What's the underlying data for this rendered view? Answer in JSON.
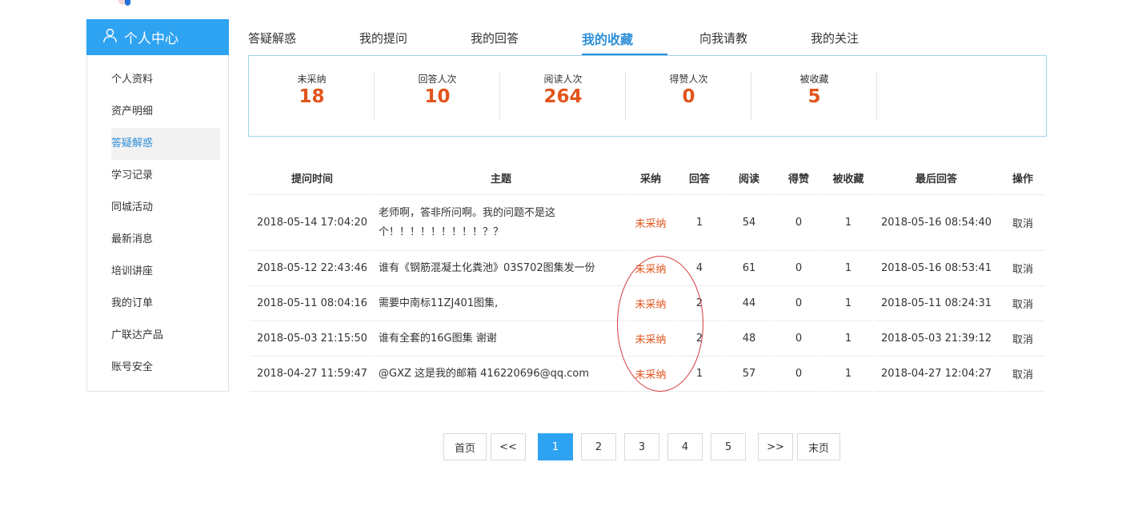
{
  "sidebar": {
    "title": "个人中心",
    "items": [
      {
        "label": "个人资料"
      },
      {
        "label": "资产明细"
      },
      {
        "label": "答疑解惑",
        "active": true
      },
      {
        "label": "学习记录"
      },
      {
        "label": "同城活动"
      },
      {
        "label": "最新消息"
      },
      {
        "label": "培训讲座"
      },
      {
        "label": "我的订单"
      },
      {
        "label": "广联达产品"
      },
      {
        "label": "账号安全"
      }
    ]
  },
  "tabs": [
    {
      "label": "答疑解惑"
    },
    {
      "label": "我的提问"
    },
    {
      "label": "我的回答"
    },
    {
      "label": "我的收藏",
      "active": true
    },
    {
      "label": "向我请教"
    },
    {
      "label": "我的关注"
    }
  ],
  "stats": [
    {
      "label": "未采纳",
      "value": "18"
    },
    {
      "label": "回答人次",
      "value": "10"
    },
    {
      "label": "阅读人次",
      "value": "264"
    },
    {
      "label": "得赞人次",
      "value": "0"
    },
    {
      "label": "被收藏",
      "value": "5"
    }
  ],
  "table": {
    "headers": [
      "提问时间",
      "主题",
      "采纳",
      "回答",
      "阅读",
      "得赞",
      "被收藏",
      "最后回答",
      "操作"
    ],
    "rows": [
      {
        "time": "2018-05-14 17:04:20",
        "topic": "老师啊，答非所问啊。我的问题不是这个！！！！！！！！！？？",
        "adopt": "未采纳",
        "answers": "1",
        "reads": "54",
        "likes": "0",
        "favorites": "1",
        "last": "2018-05-16 08:54:40",
        "action": "取消"
      },
      {
        "time": "2018-05-12 22:43:46",
        "topic": "谁有《钢筋混凝土化粪池》03S702图集发一份",
        "adopt": "未采纳",
        "answers": "4",
        "reads": "61",
        "likes": "0",
        "favorites": "1",
        "last": "2018-05-16 08:53:41",
        "action": "取消"
      },
      {
        "time": "2018-05-11 08:04:16",
        "topic": "需要中南标11ZJ401图集,",
        "adopt": "未采纳",
        "answers": "2",
        "reads": "44",
        "likes": "0",
        "favorites": "1",
        "last": "2018-05-11 08:24:31",
        "action": "取消"
      },
      {
        "time": "2018-05-03 21:15:50",
        "topic": "谁有全套的16G图集 谢谢",
        "adopt": "未采纳",
        "answers": "2",
        "reads": "48",
        "likes": "0",
        "favorites": "1",
        "last": "2018-05-03 21:39:12",
        "action": "取消"
      },
      {
        "time": "2018-04-27 11:59:47",
        "topic": "@GXZ 这是我的邮箱 416220696@qq.com",
        "adopt": "未采纳",
        "answers": "1",
        "reads": "57",
        "likes": "0",
        "favorites": "1",
        "last": "2018-04-27 12:04:27",
        "action": "取消"
      }
    ]
  },
  "pagination": {
    "first": "首页",
    "prev": "<<",
    "pages": [
      "1",
      "2",
      "3",
      "4",
      "5"
    ],
    "current": "1",
    "next": ">>",
    "last": "末页"
  },
  "icons": {
    "sidebar_header": "user-icon"
  },
  "colors": {
    "accent": "#2ea3f2",
    "highlight": "#e2541c",
    "annotation": "#d63a3a"
  }
}
